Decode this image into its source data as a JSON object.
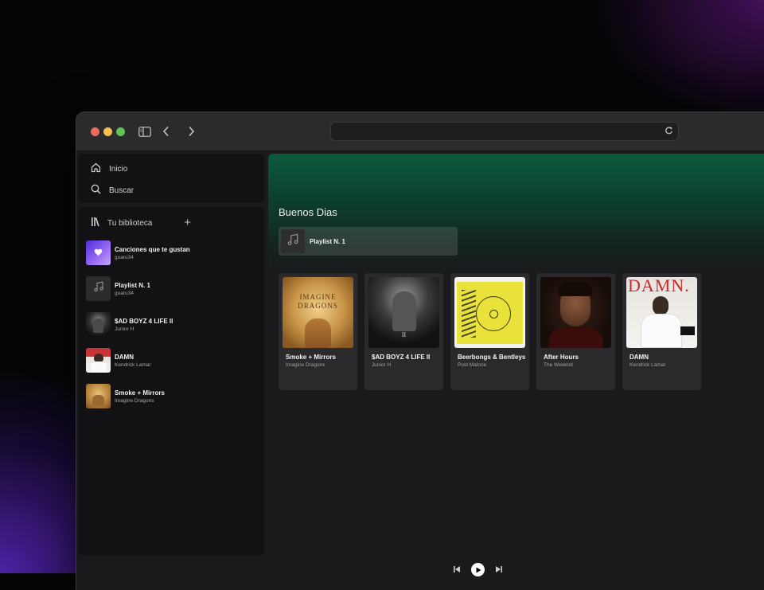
{
  "browser": {
    "url": "",
    "icons": [
      "sidebar-toggle-icon",
      "back-icon",
      "forward-icon",
      "reload-icon"
    ]
  },
  "nav": {
    "items": [
      {
        "label": "Inicio",
        "icon": "home-icon"
      },
      {
        "label": "Buscar",
        "icon": "search-icon"
      }
    ]
  },
  "library": {
    "title": "Tu biblioteca",
    "add_symbol": "+",
    "items": [
      {
        "title": "Canciones que te gustan",
        "subtitle": "guaru34",
        "cover": "liked-songs"
      },
      {
        "title": "Playlist N. 1",
        "subtitle": "guaru34",
        "cover": "music-note"
      },
      {
        "title": "$AD BOYZ 4 LIFE II",
        "subtitle": "Junior H",
        "cover": "sadboyz"
      },
      {
        "title": "DAMN",
        "subtitle": "Kendrick Lamar",
        "cover": "damn"
      },
      {
        "title": "Smoke + Mirrors",
        "subtitle": "Imagine Dragons",
        "cover": "smoke"
      }
    ]
  },
  "main": {
    "greeting": "Buenos Dias",
    "quick_pick": {
      "title": "Playlist N. 1"
    },
    "cards": [
      {
        "title": "Smoke + Mirrors",
        "subtitle": "Imagine Dragons",
        "cover": "smoke",
        "cover_text": "IMAGINE DRAGONS"
      },
      {
        "title": "$AD BOYZ 4 LIFE II",
        "subtitle": "Junior H",
        "cover": "sadboyz",
        "cover_text": "II"
      },
      {
        "title": "Beerbongs & Bentleys",
        "subtitle": "Post Malone",
        "cover": "beerbongs",
        "cover_text": ""
      },
      {
        "title": "After Hours",
        "subtitle": "The Weeknd",
        "cover": "afterhours",
        "cover_text": ""
      },
      {
        "title": "DAMN",
        "subtitle": "Kendrick Lamar",
        "cover": "damn",
        "cover_text": "DAMN."
      }
    ]
  },
  "player": {
    "controls": [
      "previous-icon",
      "play-icon",
      "next-icon"
    ]
  },
  "colors": {
    "accent_green": "#0a5a3a",
    "liked_gradient": "#7b3cf0",
    "panel": "#121214"
  }
}
